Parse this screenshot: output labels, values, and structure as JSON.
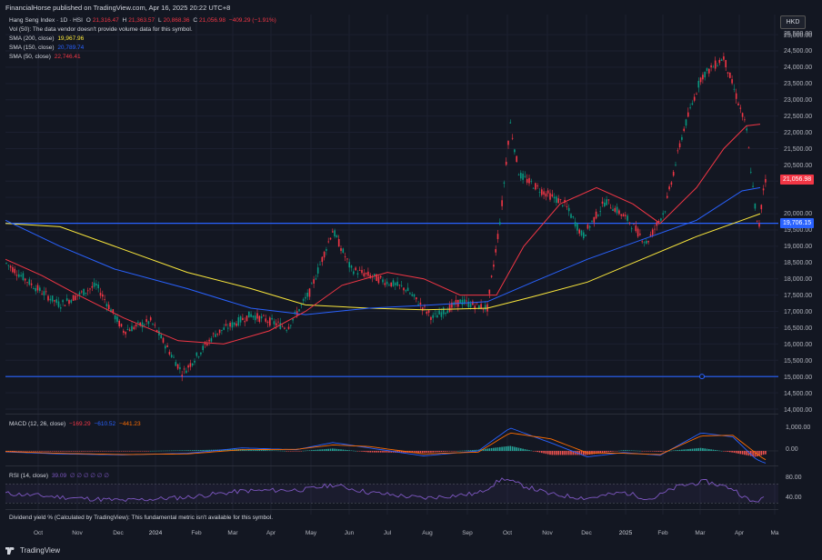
{
  "header": {
    "published": "FinancialHorse published on TradingView.com, Apr 16, 2025 20:22 UTC+8"
  },
  "legend": {
    "title": "Hang Seng Index · 1D · HSI",
    "o_label": "O",
    "o": "21,316.47",
    "h_label": "H",
    "h": "21,363.57",
    "l_label": "L",
    "l": "20,868.36",
    "c_label": "C",
    "c": "21,056.98",
    "change": "−409.29 (−1.91%)",
    "vol": "Vol (50): The data vendor doesn't provide volume data for this symbol.",
    "sma200_label": "SMA (200, close)",
    "sma200": "19,967.96",
    "sma150_label": "SMA (150, close)",
    "sma150": "20,789.74",
    "sma50_label": "SMA (50, close)",
    "sma50": "22,746.41"
  },
  "currency": "HKD",
  "price_axis": [
    "25,500.00",
    "25,000.00",
    "24,500.00",
    "24,000.00",
    "23,500.00",
    "23,000.00",
    "22,500.00",
    "22,000.00",
    "21,500.00",
    "20,500.00",
    "20,000.00",
    "19,500.00",
    "19,000.00",
    "18,500.00",
    "18,000.00",
    "17,500.00",
    "17,000.00",
    "16,500.00",
    "16,000.00",
    "15,500.00",
    "15,000.00",
    "14,500.00",
    "14,000.00"
  ],
  "last_price": "21,056.98",
  "hline_price": "19,706.15",
  "macd": {
    "label": "MACD (12, 26, close)",
    "v1": "−169.29",
    "v2": "−610.52",
    "v3": "−441.23",
    "axis": [
      "1,000.00",
      "0.00"
    ]
  },
  "rsi": {
    "label": "RSI (14, close)",
    "value": "39.09",
    "zeros": "∅ ∅ ∅ ∅ ∅ ∅",
    "axis": [
      "80.00",
      "40.00"
    ]
  },
  "dividend": "Dividend yield % (Calculated by TradingView): This fundamental metric isn't available for this symbol.",
  "time_axis": [
    "Oct",
    "Nov",
    "Dec",
    "2024",
    "Feb",
    "Mar",
    "Apr",
    "May",
    "Jun",
    "Jul",
    "Aug",
    "Sep",
    "Oct",
    "Nov",
    "Dec",
    "2025",
    "Feb",
    "Mar",
    "Apr",
    "Ma"
  ],
  "footer": {
    "brand": "TradingView"
  },
  "colors": {
    "up": "#089981",
    "down": "#f23645",
    "sma200": "#fbe83c",
    "sma150": "#2962ff",
    "sma50": "#f23645",
    "hline": "#2962ff",
    "macd": "#2962ff",
    "signal": "#ff6d00",
    "rsi": "#7e57c2"
  }
}
